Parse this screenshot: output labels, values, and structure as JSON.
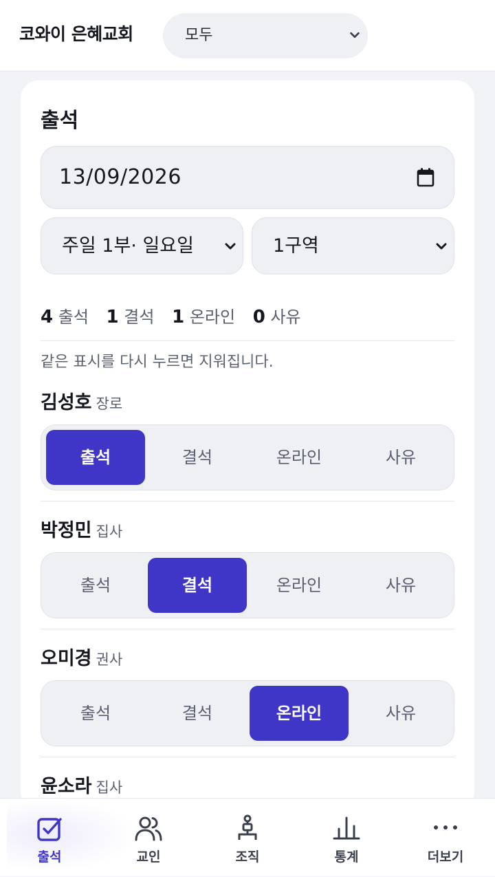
{
  "header": {
    "app_title": "코와이 은혜교회",
    "group_filter": "모두"
  },
  "attendance": {
    "title": "출석",
    "date": "13/09/2026",
    "service": "주일 1부· 일요일",
    "district": "1구역",
    "summary": {
      "present_count": "4",
      "present_label": "출석",
      "absent_count": "1",
      "absent_label": "결석",
      "online_count": "1",
      "online_label": "온라인",
      "excused_count": "0",
      "excused_label": "사유"
    },
    "hint": "같은 표시를 다시 누르면 지워집니다.",
    "status_options": [
      "출석",
      "결석",
      "온라인",
      "사유"
    ],
    "members": [
      {
        "name": "김성호",
        "role": "장로",
        "selected": "출석"
      },
      {
        "name": "박정민",
        "role": "집사",
        "selected": "결석"
      },
      {
        "name": "오미경",
        "role": "권사",
        "selected": "온라인"
      },
      {
        "name": "윤소라",
        "role": "집사",
        "selected": ""
      }
    ]
  },
  "bottom_nav": {
    "items": [
      {
        "label": "출석",
        "icon": "checkbox-icon",
        "active": true
      },
      {
        "label": "교인",
        "icon": "people-icon",
        "active": false
      },
      {
        "label": "조직",
        "icon": "org-chart-icon",
        "active": false
      },
      {
        "label": "통계",
        "icon": "bar-chart-icon",
        "active": false
      },
      {
        "label": "더보기",
        "icon": "more-dots-icon",
        "active": false
      }
    ]
  },
  "colors": {
    "accent": "#3f35c7",
    "background": "#f1f3f7",
    "field": "#eef0f4"
  }
}
